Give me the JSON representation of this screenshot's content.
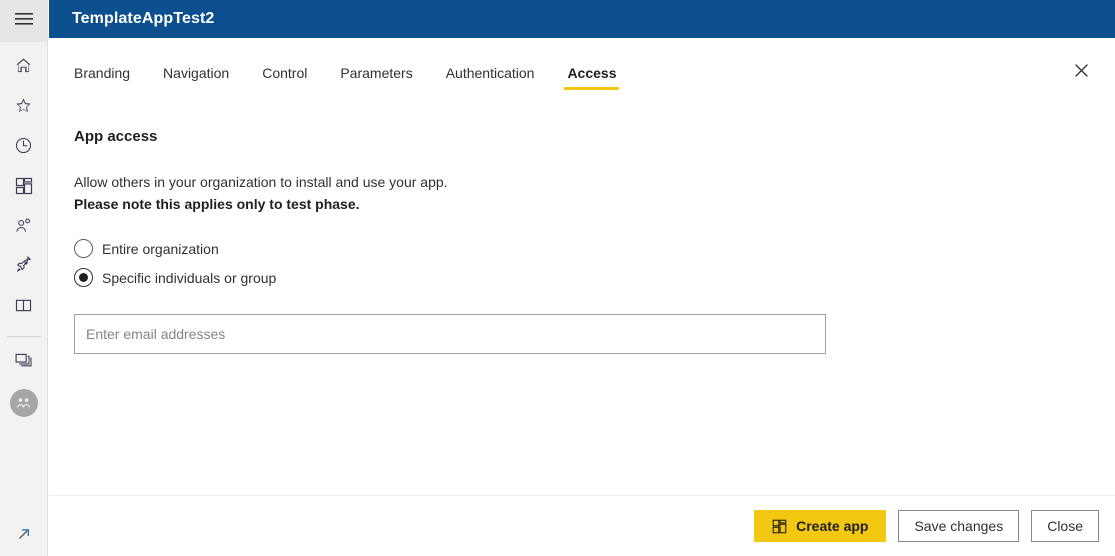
{
  "colors": {
    "header_blue": "#0c4f8f",
    "accent_yellow": "#f2c811",
    "rail_bg": "#f3f2f1",
    "text": "#323130"
  },
  "nav_rail": {
    "menu": {
      "label": "Menu",
      "icon": "hamburger-icon"
    },
    "items": [
      {
        "label": "Home",
        "icon": "home-icon"
      },
      {
        "label": "Favorites",
        "icon": "star-icon"
      },
      {
        "label": "Recent",
        "icon": "clock-icon"
      },
      {
        "label": "Apps",
        "icon": "apps-grid-icon"
      },
      {
        "label": "Shared with me",
        "icon": "people-icon"
      },
      {
        "label": "Deployment pipelines",
        "icon": "rocket-icon"
      },
      {
        "label": "Learn",
        "icon": "book-icon"
      }
    ],
    "workspace": {
      "label": "Workspaces",
      "icon": "workspaces-icon"
    },
    "current_workspace": {
      "label": "Workspace avatar",
      "icon": "workspace-avatar-icon"
    },
    "expand": {
      "label": "Expand",
      "icon": "arrow-up-right-icon"
    }
  },
  "header": {
    "title": "TemplateAppTest2"
  },
  "tabs": [
    {
      "label": "Branding",
      "active": false
    },
    {
      "label": "Navigation",
      "active": false
    },
    {
      "label": "Control",
      "active": false
    },
    {
      "label": "Parameters",
      "active": false
    },
    {
      "label": "Authentication",
      "active": false
    },
    {
      "label": "Access",
      "active": true
    }
  ],
  "close_button": {
    "label": "Close",
    "icon": "close-icon"
  },
  "main": {
    "section_title": "App access",
    "description_line1": "Allow others in your organization to install and use your app.",
    "description_line2": "Please note this applies only to test phase.",
    "radio_options": [
      {
        "label": "Entire organization",
        "selected": false
      },
      {
        "label": "Specific individuals or group",
        "selected": true
      }
    ],
    "email_input": {
      "placeholder": "Enter email addresses",
      "value": ""
    }
  },
  "footer": {
    "create_app_label": "Create app",
    "create_app_icon": "apps-grid-icon",
    "save_changes_label": "Save changes",
    "close_label": "Close"
  }
}
